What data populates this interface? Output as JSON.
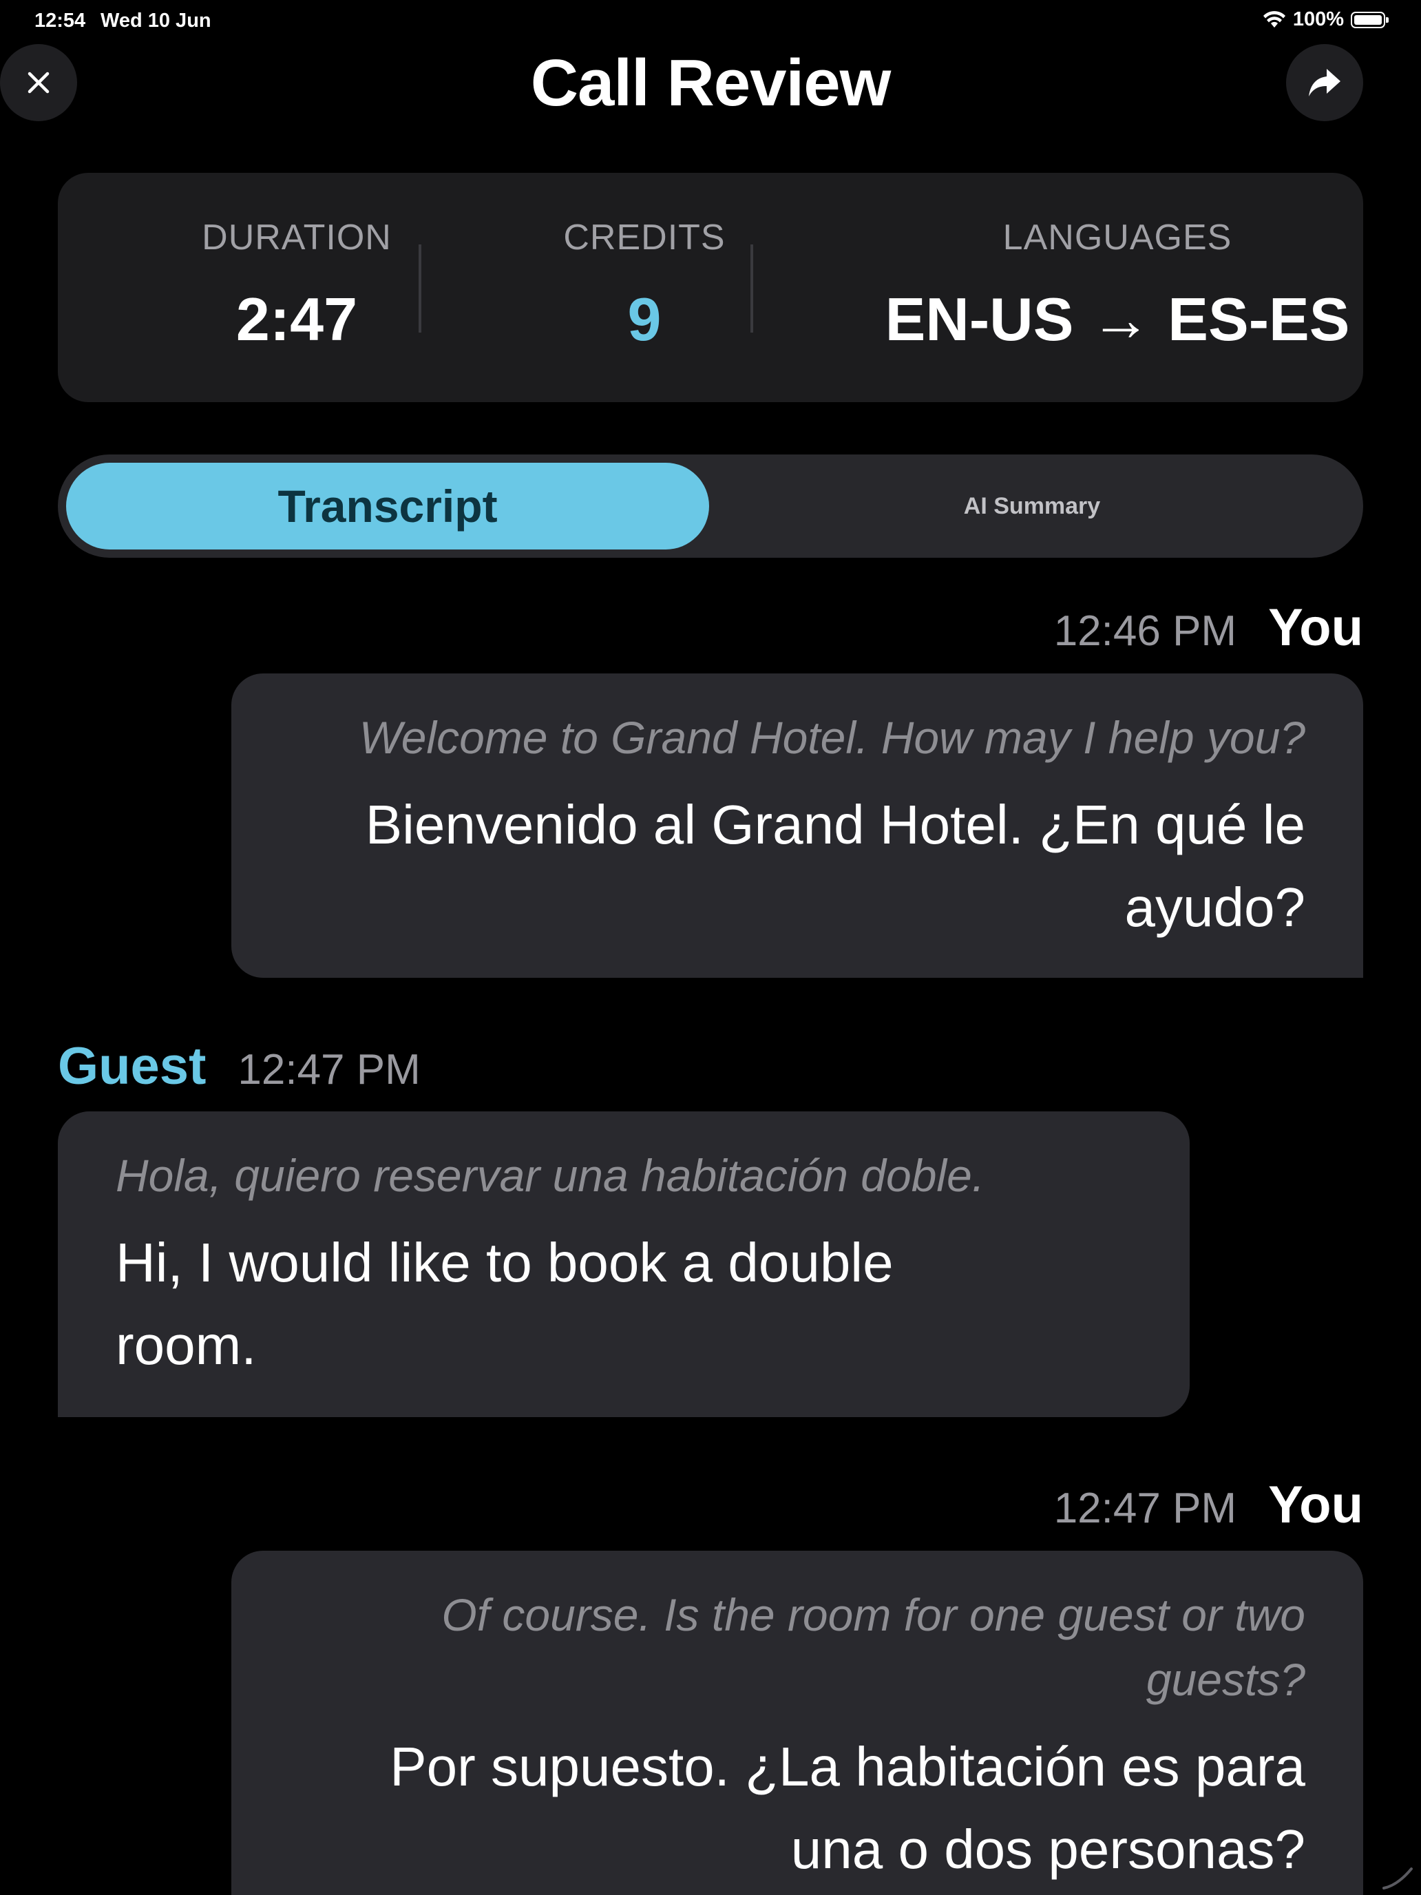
{
  "status_bar": {
    "time": "12:54",
    "date": "Wed 10 Jun",
    "battery": "100%"
  },
  "header": {
    "title": "Call Review",
    "close_icon": "close-icon",
    "share_icon": "share-icon"
  },
  "stats": {
    "duration_label": "DURATION",
    "duration_value": "2:47",
    "credits_label": "CREDITS",
    "credits_value": "9",
    "languages_label": "LANGUAGES",
    "languages_value": "EN-US → ES-ES"
  },
  "tabs": {
    "transcript": "Transcript",
    "ai_summary": "AI Summary",
    "selected": "Transcript"
  },
  "messages": [
    {
      "sender": "You",
      "time": "12:46 PM",
      "original": "Welcome to Grand Hotel. How may I help you?",
      "translation_line1": "Bienvenido al Grand Hotel. ¿En qué le",
      "translation_line2": "ayudo?"
    },
    {
      "sender": "Guest",
      "time": "12:47 PM",
      "original": "Hola, quiero reservar una habitación doble.",
      "translation_line1": "Hi, I would like to book a double",
      "translation_line2": "room."
    },
    {
      "sender": "You",
      "time": "12:47 PM",
      "original_line1": "Of course. Is the room for one guest or two",
      "original_line2": "guests?",
      "translation_line1": "Por supuesto. ¿La habitación es para",
      "translation_line2": "una o dos personas?"
    }
  ],
  "colors": {
    "background": "#000000",
    "card": "#1c1c1e",
    "bubble": "#29292e",
    "accent": "#6ac8e6"
  }
}
